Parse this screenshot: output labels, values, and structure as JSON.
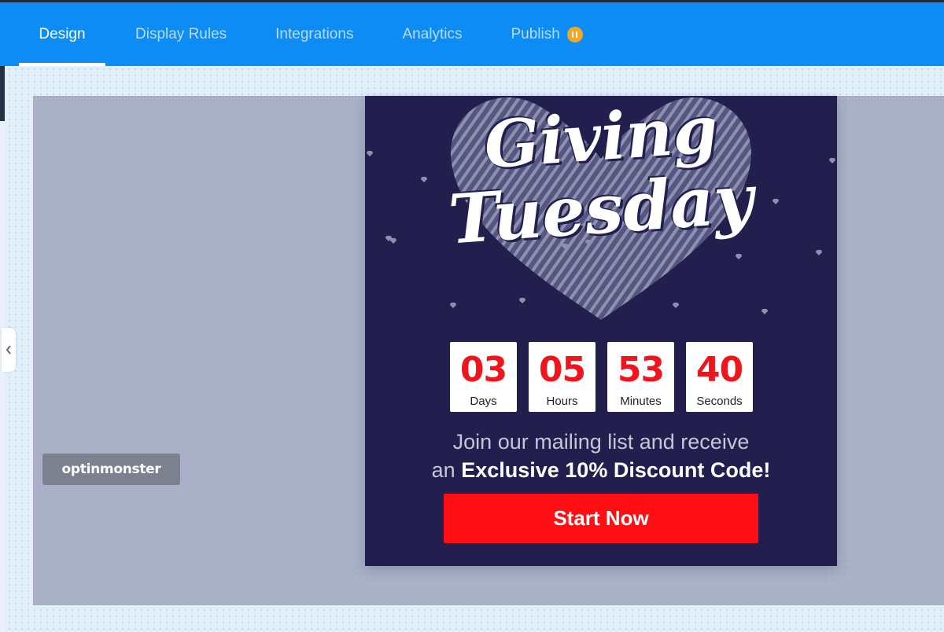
{
  "nav": {
    "tabs": [
      {
        "label": "Design"
      },
      {
        "label": "Display Rules"
      },
      {
        "label": "Integrations"
      },
      {
        "label": "Analytics"
      },
      {
        "label": "Publish"
      }
    ],
    "active_tab": "Design",
    "publish_status_icon": "pause-icon",
    "colors": {
      "bar": "#0d8cf6",
      "publish_badge": "#f4a724"
    }
  },
  "branding": {
    "badge_text": "optinmonster"
  },
  "popup": {
    "title_line1": "Giving",
    "title_line2": "Tuesday",
    "countdown": [
      {
        "value": "03",
        "label": "Days"
      },
      {
        "value": "05",
        "label": "Hours"
      },
      {
        "value": "53",
        "label": "Minutes"
      },
      {
        "value": "40",
        "label": "Seconds"
      }
    ],
    "message_line1": "Join our mailing list and receive",
    "message_line2_prefix": "an",
    "message_line2_bold": "Exclusive 10% Discount Code!",
    "cta_label": "Start Now",
    "colors": {
      "background": "#221f4f",
      "accent": "#ff0f14",
      "countdown_number": "#f0141c"
    }
  }
}
